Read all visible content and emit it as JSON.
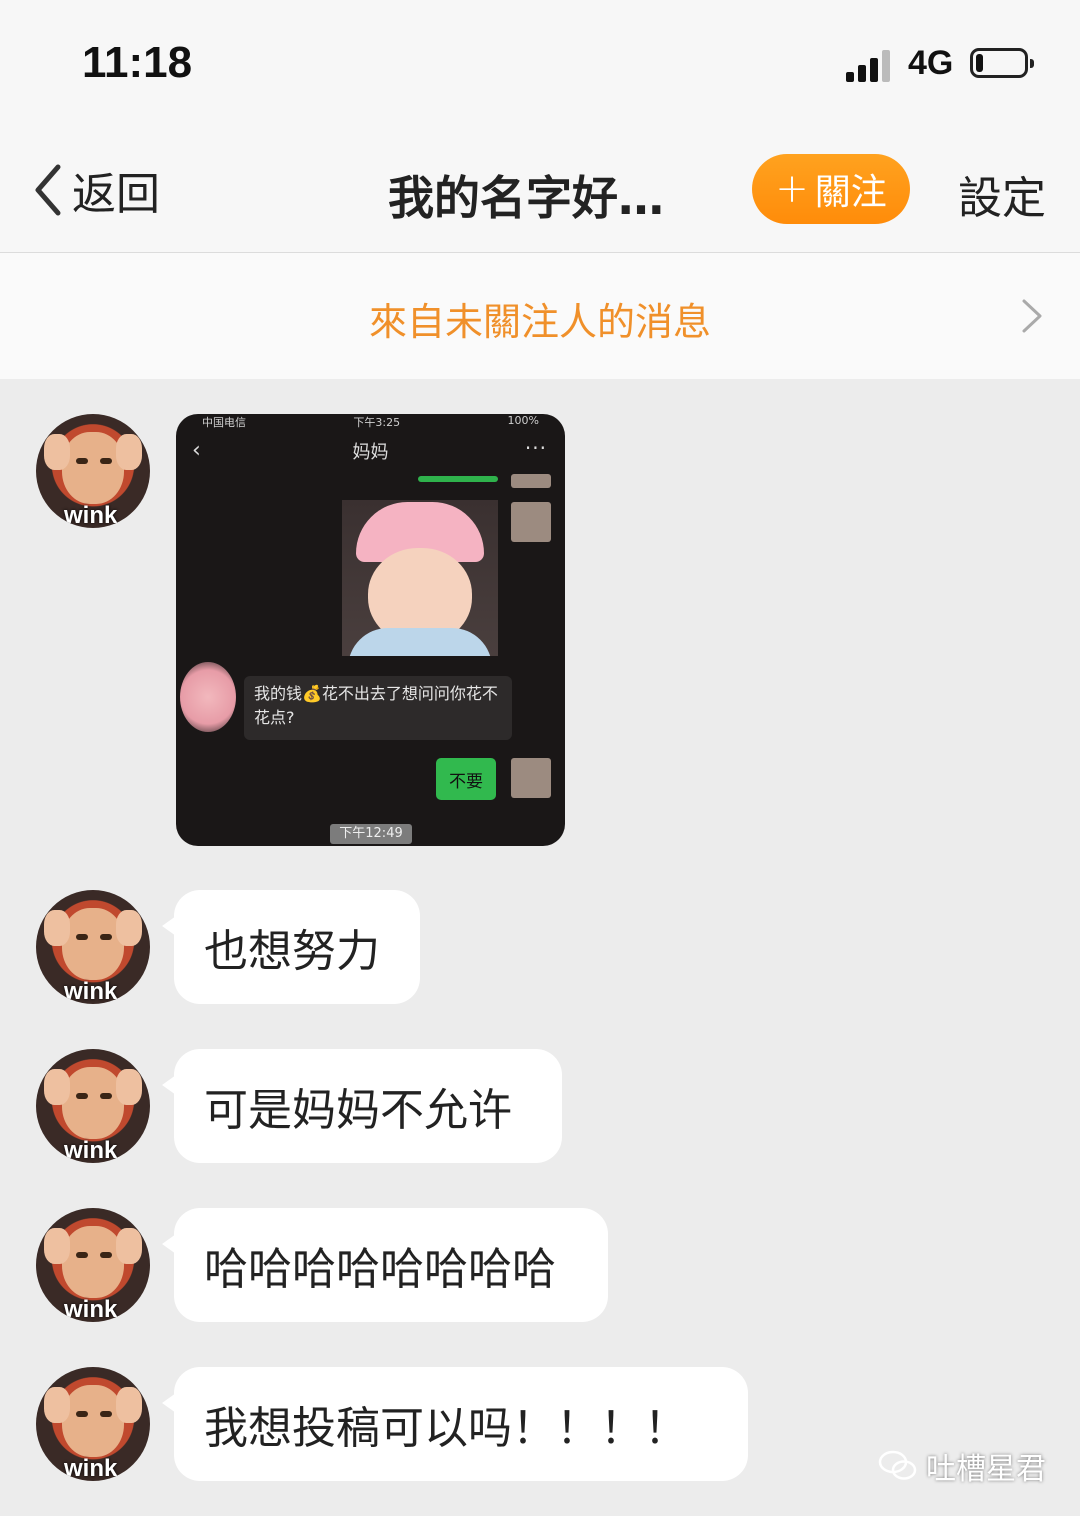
{
  "status": {
    "time": "11:18",
    "network": "4G",
    "battery_level": 0.15
  },
  "nav": {
    "back_label": "返回",
    "title": "我的名字好…",
    "follow_label": "關注",
    "settings_label": "設定"
  },
  "notice": {
    "text": "來自未關注人的消息"
  },
  "accent_color": "#ff9214",
  "avatar_tag": "wink",
  "image_message": {
    "status_left": "中国电信",
    "status_center": "下午3:25",
    "status_right": "100%",
    "title": "妈妈",
    "quoted_text": "我的钱💰花不出去了想问问你花不花点?",
    "reply": "不要",
    "time": "下午12:49"
  },
  "messages": [
    {
      "text": "也想努力"
    },
    {
      "text": "可是妈妈不允许"
    },
    {
      "text": "哈哈哈哈哈哈哈哈"
    },
    {
      "text": "我想投稿可以吗！！！！"
    }
  ],
  "watermark": "吐槽星君"
}
